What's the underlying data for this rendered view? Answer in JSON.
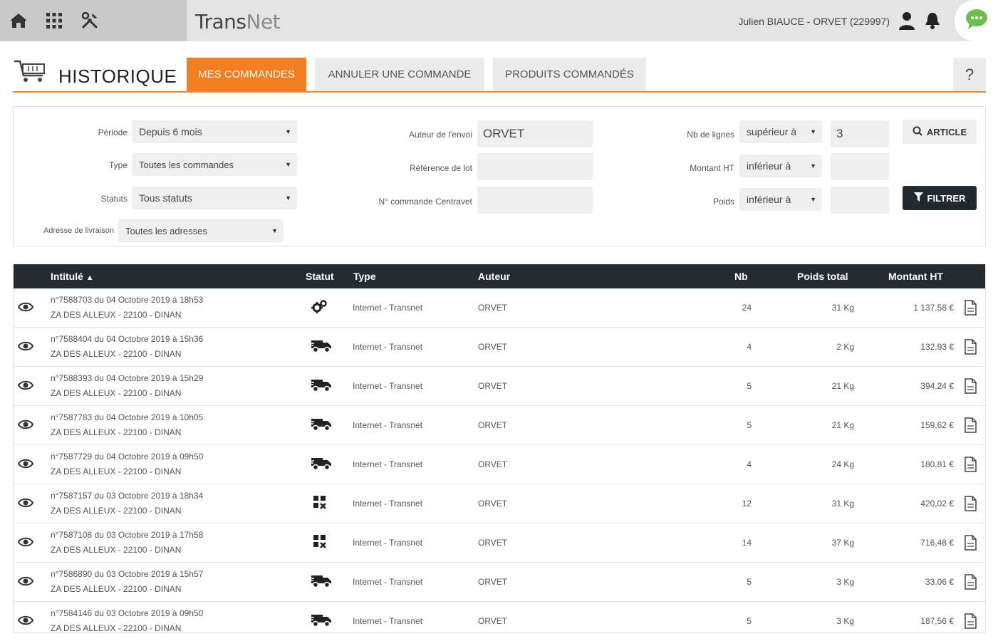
{
  "topbar": {
    "brand_part1": "Trans",
    "brand_part2": "Net",
    "user": "Julien BIAUCE - ORVET (229997)",
    "icons": [
      "home-icon",
      "apps-grid-icon",
      "tools-icon",
      "user-icon",
      "bell-icon",
      "chat-icon"
    ]
  },
  "header": {
    "title": "HISTORIQUE",
    "tabs": [
      "MES COMMANDES",
      "ANNULER UNE COMMANDE",
      "PRODUITS COMMANDÉS"
    ],
    "active_tab": "MES COMMANDES",
    "help": "?"
  },
  "filters": {
    "periode_label": "Période",
    "periode_value": "Depuis 6 mois",
    "type_label": "Type",
    "type_value": "Toutes les commandes",
    "statuts_label": "Statuts",
    "statuts_value": "Tous statuts",
    "adresse_label": "Adresse de livraison",
    "adresse_value": "Toutes les adresses",
    "auteur_label": "Auteur de l'envoi",
    "auteur_value": "ORVET",
    "reference_label": "Référence de lot",
    "reference_value": "",
    "commande_label": "N° commande Centravet",
    "commande_value": "",
    "nblignes_label": "Nb de lignes",
    "nblignes_op": "supérieur à",
    "nblignes_value": "3",
    "montant_label": "Montant HT",
    "montant_op": "inférieur à",
    "montant_value": "",
    "poids_label": "Poids",
    "poids_op": "inférieur à",
    "poids_value": "",
    "article_button": "ARTICLE",
    "filter_button": "FILTRER"
  },
  "table": {
    "columns": {
      "intitule": "Intitulé",
      "statut": "Statut",
      "type": "Type",
      "auteur": "Auteur",
      "nb": "Nb",
      "poids": "Poids total",
      "montant": "Montant HT"
    },
    "sort_indicator": "▲",
    "rows": [
      {
        "title": "n°7588703 du 04 Octobre 2019 à 18h53",
        "address": "ZA DES ALLEUX - 22100 - DINAN",
        "status_icon": "gears-icon",
        "type": "Internet - Transnet",
        "auteur": "ORVET",
        "nb": "24",
        "poids": "31 Kg",
        "montant": "1 137,58 €"
      },
      {
        "title": "n°7588404 du 04 Octobre 2019 à 15h36",
        "address": "ZA DES ALLEUX - 22100 - DINAN",
        "status_icon": "truck-icon",
        "type": "Internet - Transnet",
        "auteur": "ORVET",
        "nb": "4",
        "poids": "2 Kg",
        "montant": "132,93 €"
      },
      {
        "title": "n°7588393 du 04 Octobre 2019 à 15h29",
        "address": "ZA DES ALLEUX - 22100 - DINAN",
        "status_icon": "truck-icon",
        "type": "Internet - Transnet",
        "auteur": "ORVET",
        "nb": "5",
        "poids": "21 Kg",
        "montant": "394,24 €"
      },
      {
        "title": "n°7587783 du 04 Octobre 2019 à 10h05",
        "address": "ZA DES ALLEUX - 22100 - DINAN",
        "status_icon": "truck-icon",
        "type": "Internet - Transnet",
        "auteur": "ORVET",
        "nb": "5",
        "poids": "21 Kg",
        "montant": "159,62 €"
      },
      {
        "title": "n°7587729 du 04 Octobre 2019 à 09h50",
        "address": "ZA DES ALLEUX - 22100 - DINAN",
        "status_icon": "truck-icon",
        "type": "Internet - Transnet",
        "auteur": "ORVET",
        "nb": "4",
        "poids": "24 Kg",
        "montant": "180,81 €"
      },
      {
        "title": "n°7587157 du 03 Octobre 2019 à 18h34",
        "address": "ZA DES ALLEUX - 22100 - DINAN",
        "status_icon": "packing-icon",
        "type": "Internet - Transnet",
        "auteur": "ORVET",
        "nb": "12",
        "poids": "31 Kg",
        "montant": "420,02 €"
      },
      {
        "title": "n°7587108 du 03 Octobre 2019 à 17h58",
        "address": "ZA DES ALLEUX - 22100 - DINAN",
        "status_icon": "packing-icon",
        "type": "Internet - Transnet",
        "auteur": "ORVET",
        "nb": "14",
        "poids": "37 Kg",
        "montant": "716,48 €"
      },
      {
        "title": "n°7586890 du 03 Octobre 2019 à 15h57",
        "address": "ZA DES ALLEUX - 22100 - DINAN",
        "status_icon": "truck-icon",
        "type": "Internet - Transnet",
        "auteur": "ORVET",
        "nb": "5",
        "poids": "3 Kg",
        "montant": "33,06 €"
      },
      {
        "title": "n°7584146 du 03 Octobre 2019 à 09h50",
        "address": "ZA DES ALLEUX - 22100 - DINAN",
        "status_icon": "truck-icon",
        "type": "Internet - Transnet",
        "auteur": "ORVET",
        "nb": "5",
        "poids": "3 Kg",
        "montant": "187,56 €"
      }
    ]
  },
  "colors": {
    "accent": "#f47d1f",
    "header_dark": "#242c31",
    "chat_green": "#6cc04a"
  }
}
